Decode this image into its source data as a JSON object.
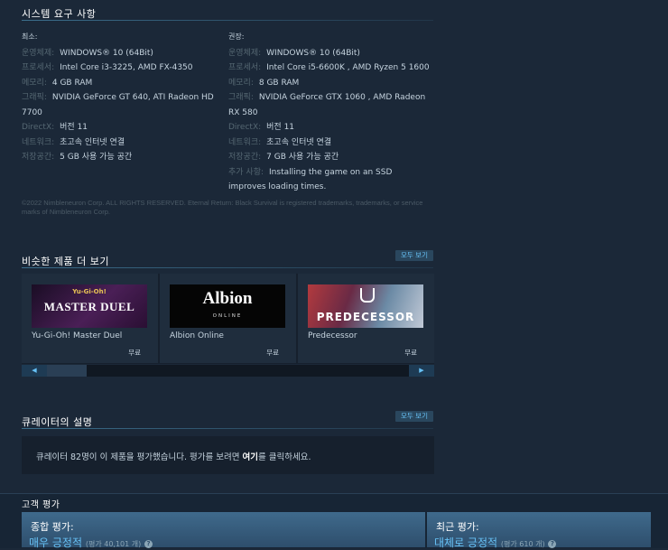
{
  "sysreq": {
    "title": "시스템 요구 사항",
    "minimum": {
      "heading": "최소:",
      "rows": [
        {
          "label": "운영체제:",
          "value": "WINDOWS® 10 (64Bit)"
        },
        {
          "label": "프로세서:",
          "value": "Intel Core i3-3225, AMD FX-4350"
        },
        {
          "label": "메모리:",
          "value": "4 GB RAM"
        },
        {
          "label": "그래픽:",
          "value": "NVIDIA GeForce GT 640, ATI Radeon HD 7700"
        },
        {
          "label": "DirectX:",
          "value": "버전 11"
        },
        {
          "label": "네트워크:",
          "value": "초고속 인터넷 연결"
        },
        {
          "label": "저장공간:",
          "value": "5 GB 사용 가능 공간"
        }
      ]
    },
    "recommended": {
      "heading": "권장:",
      "rows": [
        {
          "label": "운영체제:",
          "value": "WINDOWS® 10 (64Bit)"
        },
        {
          "label": "프로세서:",
          "value": "Intel Core i5-6600K , AMD Ryzen 5 1600"
        },
        {
          "label": "메모리:",
          "value": "8 GB RAM"
        },
        {
          "label": "그래픽:",
          "value": "NVIDIA GeForce GTX 1060 , AMD Radeon RX 580"
        },
        {
          "label": "DirectX:",
          "value": "버전 11"
        },
        {
          "label": "네트워크:",
          "value": "초고속 인터넷 연결"
        },
        {
          "label": "저장공간:",
          "value": "7 GB 사용 가능 공간"
        },
        {
          "label": "추가 사항:",
          "value": "Installing the game on an SSD improves loading times."
        }
      ]
    },
    "legal": "©2022 Nimbleneuron Corp. ALL RIGHTS RESERVED. Eternal Return: Black Survival is registered trademarks, trademarks, or service marks of Nimbleneuron Corp."
  },
  "similar": {
    "title": "비슷한 제품 더 보기",
    "see_all": "모두 보기",
    "items": [
      {
        "name": "Yu-Gi-Oh! Master Duel",
        "price": "무료",
        "logo_top": "Yu-Gi-Oh!",
        "logo_main": "MASTER DUEL"
      },
      {
        "name": "Albion Online",
        "price": "무료",
        "logo_top": "Albion",
        "logo_main": "ONLINE"
      },
      {
        "name": "Predecessor",
        "price": "무료",
        "logo_main": "PREDECESSOR"
      }
    ]
  },
  "curator": {
    "title": "큐레이터의 설명",
    "see_all": "모두 보기",
    "text_before": "큐레이터 82명이 이 제품을 평가했습니다. 평가를 보려면 ",
    "link": "여기",
    "text_after": "를 클릭하세요."
  },
  "reviews": {
    "title": "고객 평가",
    "overall": {
      "label": "종합 평가:",
      "summary": "매우 긍정적",
      "count": "(평가 40,101 개)"
    },
    "recent": {
      "label": "최근 평가:",
      "summary": "대체로 긍정적",
      "count": "(평가 610 개)"
    }
  },
  "colors": {
    "accent": "#67c1f5",
    "background": "#1b2838"
  }
}
